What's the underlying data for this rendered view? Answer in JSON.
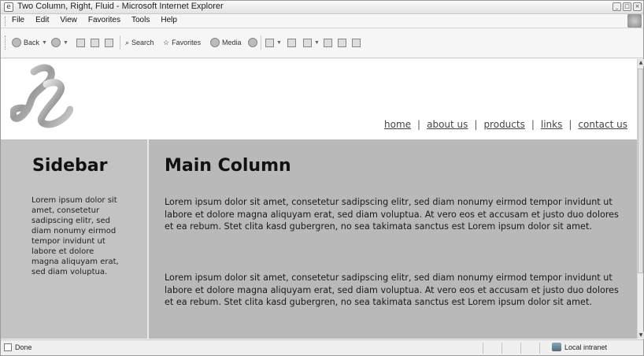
{
  "window": {
    "title": "Two Column, Right, Fluid - Microsoft Internet Explorer"
  },
  "menubar": {
    "items": [
      "File",
      "Edit",
      "View",
      "Favorites",
      "Tools",
      "Help"
    ]
  },
  "toolbar": {
    "back_label": "Back",
    "search_label": "Search",
    "favorites_label": "Favorites",
    "media_label": "Media"
  },
  "page": {
    "nav": [
      "home",
      "about us",
      "products",
      "links",
      "contact us"
    ],
    "sidebar": {
      "heading": "Sidebar",
      "text": "Lorem ipsum dolor sit amet, consetetur sadipscing elitr, sed diam nonumy eirmod tempor invidunt ut labore et dolore magna aliquyam erat, sed diam voluptua."
    },
    "main": {
      "heading": "Main Column",
      "paragraphs": [
        "Lorem ipsum dolor sit amet, consetetur sadipscing elitr, sed diam nonumy eirmod tempor invidunt ut labore et dolore magna aliquyam erat, sed diam voluptua. At vero eos et accusam et justo duo dolores et ea rebum. Stet clita kasd gubergren, no sea takimata sanctus est Lorem ipsum dolor sit amet.",
        "Lorem ipsum dolor sit amet, consetetur sadipscing elitr, sed diam nonumy eirmod tempor invidunt ut labore et dolore magna aliquyam erat, sed diam voluptua. At vero eos et accusam et justo duo dolores et ea rebum. Stet clita kasd gubergren, no sea takimata sanctus est Lorem ipsum dolor sit amet."
      ]
    }
  },
  "statusbar": {
    "status": "Done",
    "zone": "Local intranet"
  },
  "colors": {
    "content_background": "#b9b9b9",
    "sidebar_background": "#c3c3c3"
  }
}
